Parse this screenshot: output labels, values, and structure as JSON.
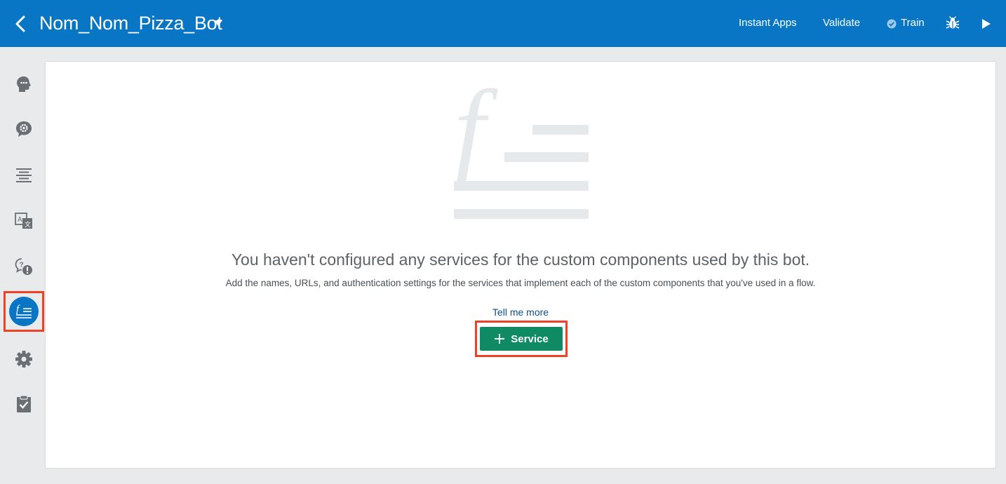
{
  "header": {
    "bot_name": "Nom_Nom_Pizza_Bot",
    "actions": {
      "instant_apps": "Instant Apps",
      "validate": "Validate",
      "train": "Train"
    }
  },
  "sidebar": {
    "items": [
      {
        "icon": "intents-head-icon"
      },
      {
        "icon": "entities-bubble-gear-icon"
      },
      {
        "icon": "flows-lines-icon"
      },
      {
        "icon": "resource-bundles-translate-icon"
      },
      {
        "icon": "qna-question-bubble-icon"
      },
      {
        "icon": "components-function-icon",
        "active": true
      },
      {
        "icon": "settings-gear-icon"
      },
      {
        "icon": "insights-clipboard-icon"
      }
    ]
  },
  "main": {
    "empty_state": {
      "headline": "You haven't configured any services for the custom components used by this bot.",
      "description": "Add the names, URLs, and authentication settings for the services that implement each of the custom components that you've used in a flow.",
      "link": "Tell me more",
      "button": "Service"
    }
  },
  "colors": {
    "header_bg": "#0876c5",
    "accent_green": "#0f8a63",
    "highlight_red": "#ef4123",
    "icon_gray": "#6b6f73",
    "hero_gray": "#e6e9ec"
  }
}
